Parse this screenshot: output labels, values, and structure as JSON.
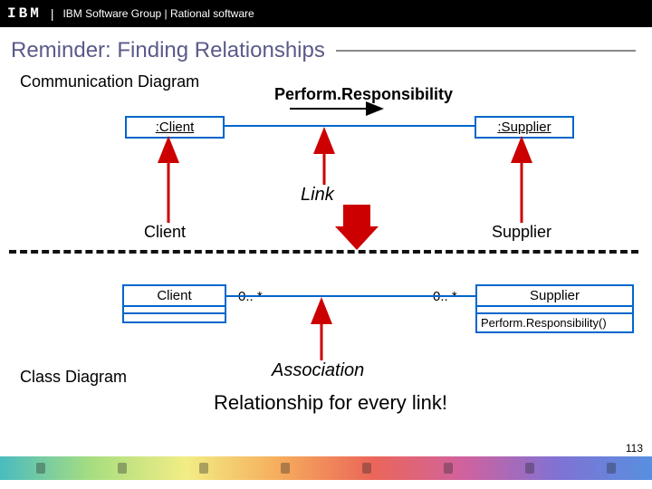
{
  "header": {
    "logo": "IBM",
    "text": "IBM Software Group | Rational software"
  },
  "title": "Reminder: Finding Relationships",
  "labels": {
    "comm_diagram": "Communication Diagram",
    "class_diagram": "Class Diagram",
    "perform_resp": "Perform.Responsibility",
    "link": "Link",
    "client": "Client",
    "supplier": "Supplier",
    "association": "Association",
    "relationship": "Relationship for every link!"
  },
  "objects": {
    "client": ":Client",
    "supplier": ":Supplier"
  },
  "classes": {
    "client": "Client",
    "supplier": "Supplier",
    "supplier_op": "Perform.Responsibility()"
  },
  "multiplicity": {
    "left": "0.. *",
    "right": "0.. *"
  },
  "slide_number": "113"
}
